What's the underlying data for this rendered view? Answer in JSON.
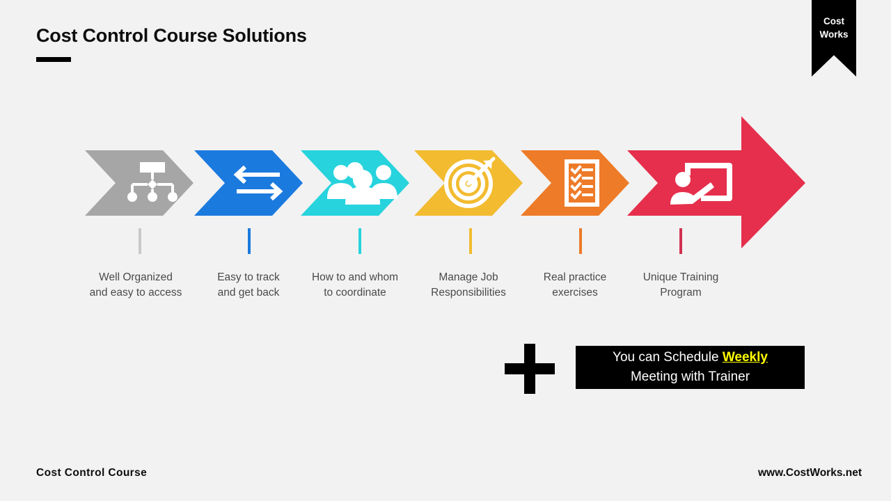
{
  "slide": {
    "title": "Cost Control Course Solutions",
    "background_color": "#f2f2f2"
  },
  "logo": {
    "name": "cost-works-ribbon",
    "line_1": "Cost",
    "line_2": "Works",
    "background_color": "#000000",
    "text_color": "#ffffff"
  },
  "process": {
    "steps": [
      {
        "index": 1,
        "icon": "org-chart-icon",
        "color": "#a6a6a6",
        "label": "Well Organized\nand easy to access",
        "label_center_x": 195
      },
      {
        "index": 2,
        "icon": "exchange-arrows-icon",
        "color": "#1b7ade",
        "label": "Easy to track\nand get back",
        "label_center_x": 357
      },
      {
        "index": 3,
        "icon": "people-group-icon",
        "color": "#27d3dd",
        "label": "How to and whom\nto coordinate",
        "label_center_x": 510
      },
      {
        "index": 4,
        "icon": "target-dart-icon",
        "color": "#f2bb30",
        "label": "Manage Job\nResponsibilities",
        "label_center_x": 673
      },
      {
        "index": 5,
        "icon": "checklist-icon",
        "color": "#ee7b28",
        "label": "Real practice\nexercises",
        "label_center_x": 826
      },
      {
        "index": 6,
        "icon": "presenter-whiteboard-icon",
        "color": "#e52f4c",
        "label": "Unique Training\nProgram",
        "label_center_x": 978
      }
    ]
  },
  "callout": {
    "plus_icon": "plus-icon",
    "line_1_prefix": "You can Schedule ",
    "line_1_highlight": "Weekly",
    "line_2": "Meeting with Trainer",
    "background_color": "#000000",
    "text_color": "#ffffff",
    "highlight_color": "#ffff00"
  },
  "footer": {
    "left": "Cost Control  Course",
    "right": "www.CostWorks.net"
  }
}
